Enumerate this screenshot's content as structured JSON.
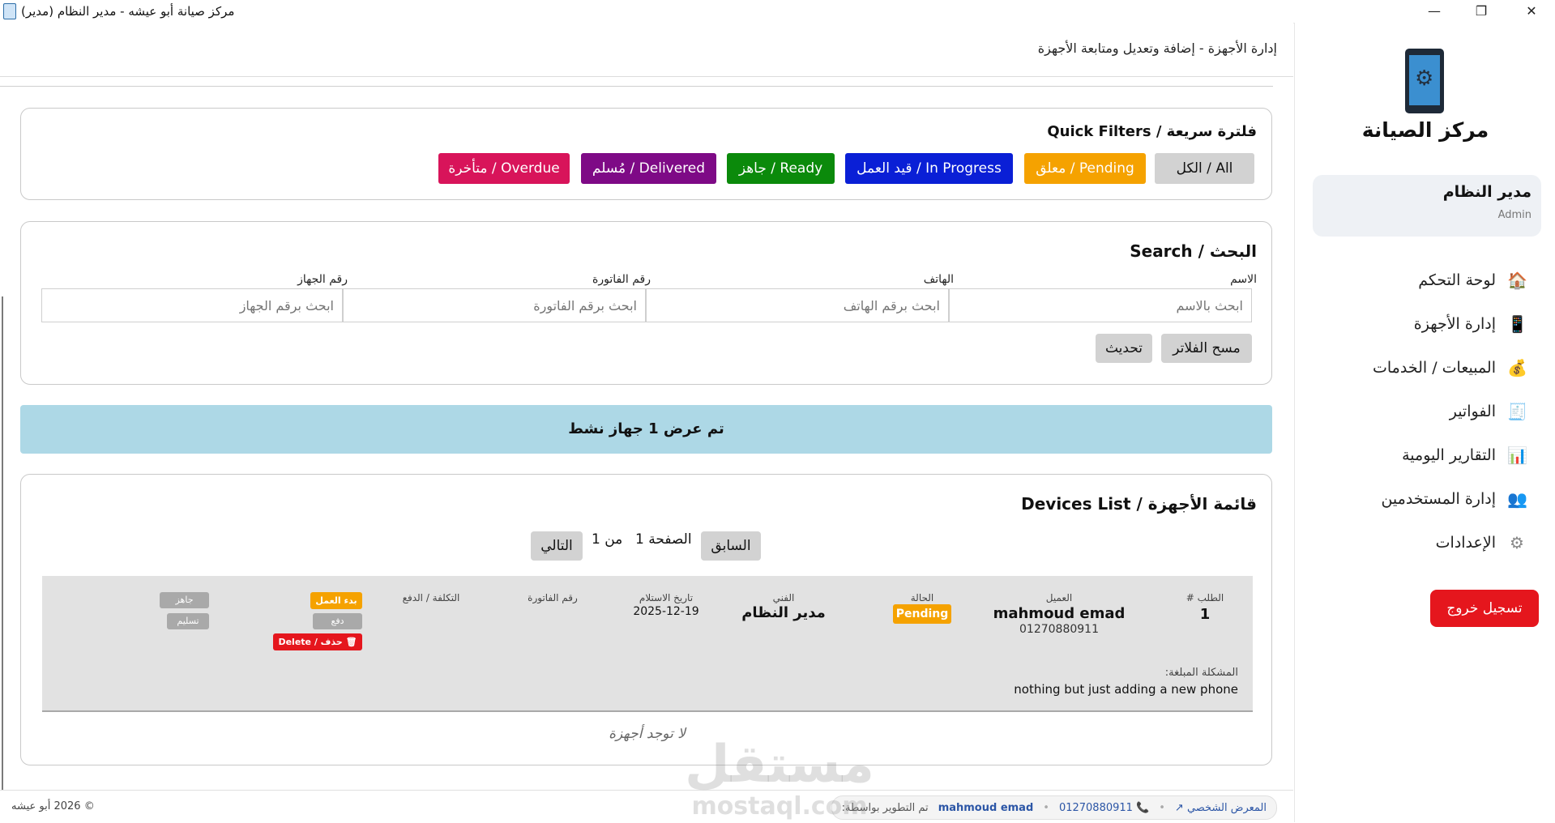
{
  "window": {
    "title": "مركز صيانة أبو عيشه - مدير النظام (مدير)",
    "minimize": "—",
    "maximize": "❐",
    "close": "✕"
  },
  "sidebar": {
    "brand": "مركز الصيانة",
    "user": {
      "name": "مدير النظام",
      "role": "Admin"
    },
    "items": [
      {
        "label": "لوحة التحكم",
        "icon": "🏠"
      },
      {
        "label": "إدارة الأجهزة",
        "icon": "📱"
      },
      {
        "label": "المبيعات / الخدمات",
        "icon": "💰"
      },
      {
        "label": "الفواتير",
        "icon": "🧾"
      },
      {
        "label": "التقارير اليومية",
        "icon": "📊"
      },
      {
        "label": "إدارة المستخدمين",
        "icon": "👥"
      },
      {
        "label": "الإعدادات",
        "icon": "⚙"
      }
    ],
    "logout": "تسجيل خروج"
  },
  "header": {
    "title": "إدارة الأجهزة - إضافة وتعديل ومتابعة الأجهزة"
  },
  "filters": {
    "title": "فلترة سريعة / Quick Filters",
    "buttons": [
      {
        "label": "All / الكل",
        "color": "#d2d2d2"
      },
      {
        "label": "Pending / معلق",
        "color": "#f5a200"
      },
      {
        "label": "In Progress / قيد العمل",
        "color": "#0a1fd6"
      },
      {
        "label": "Ready / جاهز",
        "color": "#0b8a0b"
      },
      {
        "label": "Delivered / مُسلم",
        "color": "#7e0a86"
      },
      {
        "label": "Overdue / متأخرة",
        "color": "#d8145a"
      }
    ]
  },
  "search": {
    "title": "البحث / Search",
    "fields": [
      {
        "label": "الاسم",
        "placeholder": "ابحث بالاسم"
      },
      {
        "label": "الهاتف",
        "placeholder": "ابحث برقم الهاتف"
      },
      {
        "label": "رقم الفاتورة",
        "placeholder": "ابحث برقم الفاتورة"
      },
      {
        "label": "رقم الجهاز",
        "placeholder": "ابحث برقم الجهاز"
      }
    ],
    "clear_button": "مسح الفلاتر",
    "refresh_button": "تحديث"
  },
  "banner": {
    "text": "تم عرض 1 جهاز نشط"
  },
  "devices": {
    "title": "قائمة الأجهزة / Devices List",
    "pager": {
      "prev": "السابق",
      "page_text": "الصفحة 1",
      "of_text": "من 1",
      "next": "التالي"
    },
    "columns": {
      "order": "الطلب #",
      "client": "العميل",
      "status": "الحالة",
      "tech": "الفني",
      "received": "تاريخ الاستلام",
      "invoice": "رقم الفاتورة",
      "cost": "التكلفة / الدفع"
    },
    "row": {
      "order": "1",
      "client_name": "mahmoud emad",
      "client_phone": "01270880911",
      "status": "Pending",
      "tech": "مدير النظام",
      "received": "2025-12-19",
      "actions": {
        "start": "بدء العمل",
        "pay": "دفع",
        "delete": "🗑 حذف / Delete",
        "ready": "جاهز",
        "deliver": "تسليم"
      },
      "problem_label": "المشكلة المبلغة:",
      "problem_text": "nothing but just adding a new phone"
    },
    "empty_text": "لا توجد أجهزة"
  },
  "footer": {
    "copyright": "© 2026 أبو عيشه",
    "dev_label": "تم التطوير بواسطة:",
    "dev_name": "mahmoud emad",
    "dev_phone": "📞 01270880911",
    "portfolio": "المعرض الشخصي ↗",
    "separator": "•"
  },
  "watermark": {
    "ar": "مستقل",
    "en": "mostaql.com"
  }
}
